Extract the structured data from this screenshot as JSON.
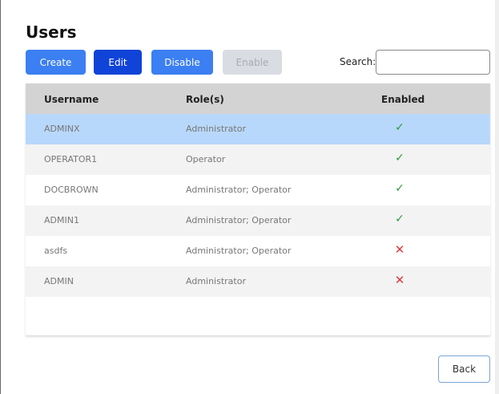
{
  "page": {
    "title": "Users"
  },
  "toolbar": {
    "create_label": "Create",
    "edit_label": "Edit",
    "disable_label": "Disable",
    "enable_label": "Enable",
    "search_label": "Search:",
    "search_value": ""
  },
  "table": {
    "headers": [
      "Username",
      "Role(s)",
      "Enabled"
    ],
    "rows": [
      {
        "username": "ADMINX",
        "roles": "Administrator",
        "enabled": true,
        "selected": true,
        "status_icon": "check-icon"
      },
      {
        "username": "OPERATOR1",
        "roles": "Operator",
        "enabled": true,
        "selected": false,
        "status_icon": "check-icon"
      },
      {
        "username": "DOCBROWN",
        "roles": "Administrator; Operator",
        "enabled": true,
        "selected": false,
        "status_icon": "check-icon"
      },
      {
        "username": "ADMIN1",
        "roles": "Administrator; Operator",
        "enabled": true,
        "selected": false,
        "status_icon": "check-icon"
      },
      {
        "username": "asdfs",
        "roles": "Administrator; Operator",
        "enabled": false,
        "selected": false,
        "status_icon": "cross-icon"
      },
      {
        "username": "ADMIN",
        "roles": "Administrator",
        "enabled": false,
        "selected": false,
        "status_icon": "cross-icon"
      }
    ]
  },
  "footer": {
    "back_label": "Back"
  },
  "colors": {
    "primary_button": "#3b7ff2",
    "active_button": "#1043d8",
    "disabled_button": "#d9dce2",
    "selected_row": "#b8d8fb",
    "enabled_check": "#2e9a3e",
    "disabled_cross": "#e23a3a"
  }
}
